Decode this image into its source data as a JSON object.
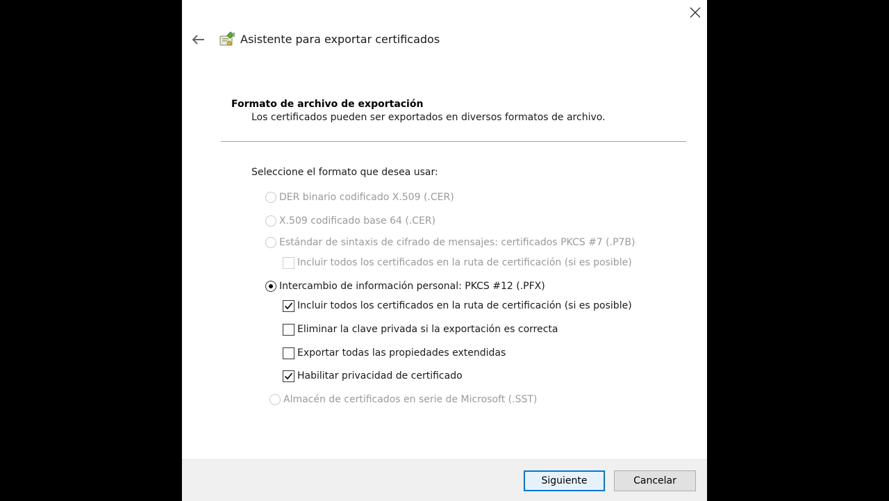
{
  "wizard": {
    "title": "Asistente para exportar certificados",
    "header_title": "Formato de archivo de exportación",
    "header_desc": "Los certificados pueden ser exportados en diversos formatos de archivo.",
    "prompt": "Seleccione el formato que desea usar:"
  },
  "options": {
    "der": {
      "label": "DER binario codificado X.509 (.CER)",
      "selected": false,
      "enabled": false
    },
    "base64": {
      "label": "X.509 codificado base 64 (.CER)",
      "selected": false,
      "enabled": false
    },
    "pkcs7": {
      "label": "Estándar de sintaxis de cifrado de mensajes: certificados PKCS #7 (.P7B)",
      "selected": false,
      "enabled": false
    },
    "pkcs7_include": {
      "label": "Incluir todos los certificados en la ruta de certificación (si es posible)",
      "checked": false,
      "enabled": false
    },
    "pfx": {
      "label": "Intercambio de información personal: PKCS #12 (.PFX)",
      "selected": true,
      "enabled": true
    },
    "pfx_include": {
      "label": "Incluir todos los certificados en la ruta de certificación (si es posible)",
      "checked": true,
      "enabled": true
    },
    "pfx_delete_key": {
      "label": "Eliminar la clave privada si la exportación es correcta",
      "checked": false,
      "enabled": true
    },
    "pfx_export_props": {
      "label": "Exportar todas las propiedades extendidas",
      "checked": false,
      "enabled": true
    },
    "pfx_privacy": {
      "label": "Habilitar privacidad de certificado",
      "checked": true,
      "enabled": true
    },
    "sst": {
      "label": "Almacén de certificados en serie de Microsoft (.SST)",
      "selected": false,
      "enabled": false
    }
  },
  "footer": {
    "next_label": "Siguiente",
    "cancel_label": "Cancelar"
  },
  "colors": {
    "accent": "#0078d7",
    "disabled_text": "#9a9a9a",
    "backdrop": "#000000"
  }
}
